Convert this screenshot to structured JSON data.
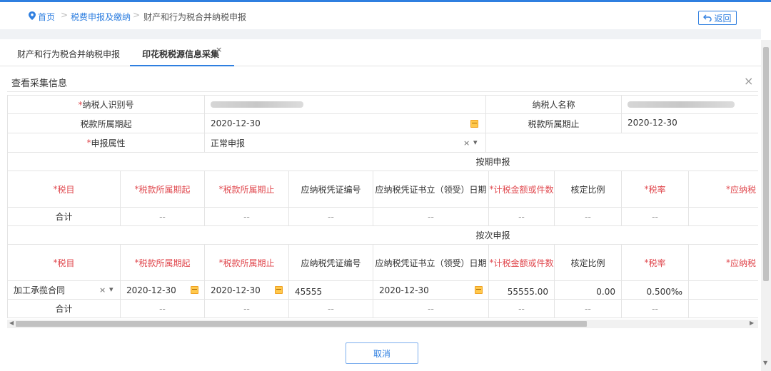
{
  "breadcrumb": {
    "home": "首页",
    "level2": "税费申报及缴纳",
    "current": "财产和行为税合并纳税申报",
    "separator": ">",
    "back_label": "返回"
  },
  "tabs": [
    {
      "label": "财产和行为税合并纳税申报"
    },
    {
      "label": "印花税税源信息采集",
      "close": "×"
    }
  ],
  "panel": {
    "title": "查看采集信息",
    "close": "×"
  },
  "form": {
    "taxpayer_id_label": "纳税人识别号",
    "taxpayer_name_label": "纳税人名称",
    "period_start_label": "税款所属期起",
    "period_start_value": "2020-12-30",
    "period_end_label": "税款所属期止",
    "period_end_value": "2020-12-30",
    "declare_attr_label": "申报属性",
    "declare_attr_value": "正常申报",
    "clear_symbol": "×",
    "dropdown_symbol": "▾",
    "required_mark": "*"
  },
  "section_periodic": {
    "title": "按期申报"
  },
  "section_per_time": {
    "title": "按次申报"
  },
  "columns": [
    "税目",
    "税款所属期起",
    "税款所属期止",
    "应纳税凭证编号",
    "应纳税凭证书立（领受）日期",
    "计税金额或件数",
    "核定比例",
    "税率",
    "应纳税"
  ],
  "required_columns": [
    true,
    true,
    true,
    false,
    false,
    true,
    false,
    true,
    true
  ],
  "periodic_total": {
    "label": "合计",
    "values": [
      "--",
      "--",
      "--",
      "--",
      "--",
      "--",
      "--",
      "--"
    ]
  },
  "per_time_row": {
    "tax_item": "加工承揽合同",
    "period_start": "2020-12-30",
    "period_end": "2020-12-30",
    "voucher_no": "45555",
    "voucher_date": "2020-12-30",
    "amount": "55555.00",
    "ratio": "0.00",
    "rate": "0.500‰"
  },
  "per_time_total": {
    "label": "合计",
    "values": [
      "--",
      "--",
      "--",
      "--",
      "--",
      "--",
      "--",
      "--"
    ]
  },
  "footer": {
    "cancel_label": "取消"
  },
  "colors": {
    "accent": "#2f7fe0",
    "required": "#e0484e",
    "calendar": "#ffc94d"
  }
}
